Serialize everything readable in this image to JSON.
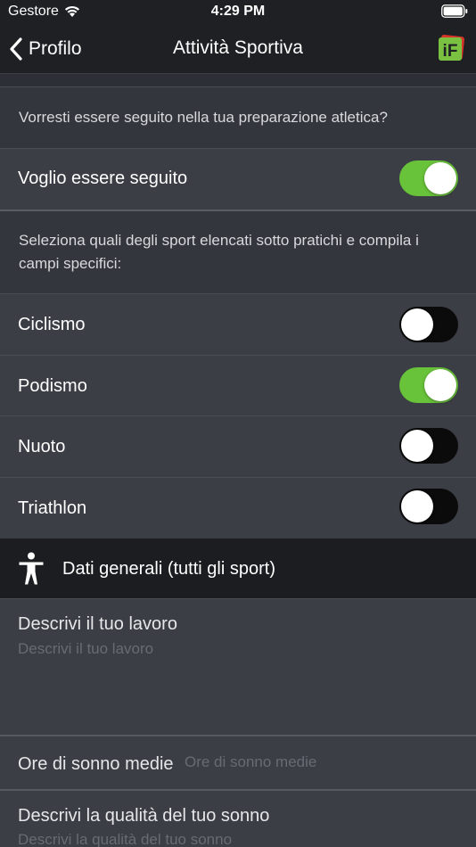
{
  "status_bar": {
    "carrier": "Gestore",
    "time": "4:29 PM",
    "wifi_icon": "wifi-icon",
    "battery_icon": "battery-icon"
  },
  "nav": {
    "back_label": "Profilo",
    "title": "Attività Sportiva",
    "logo_text": "iF",
    "logo_color": "#7ac142"
  },
  "follow_section": {
    "question": "Vorresti essere seguito nella tua preparazione atletica?",
    "toggle_label": "Voglio essere seguito",
    "toggle_on": true
  },
  "sports_section": {
    "instructions": "Seleziona quali degli sport elencati sotto pratichi e compila i campi specifici:",
    "sports": [
      {
        "label": "Ciclismo",
        "on": false
      },
      {
        "label": "Podismo",
        "on": true
      },
      {
        "label": "Nuoto",
        "on": false
      },
      {
        "label": "Triathlon",
        "on": false
      }
    ]
  },
  "general_section": {
    "header": "Dati generali (tutti gli sport)",
    "header_icon": "person-icon",
    "job": {
      "label": "Descrivi il tuo lavoro",
      "placeholder": "Descrivi il tuo lavoro",
      "value": ""
    },
    "sleep_hours": {
      "label": "Ore di sonno medie",
      "placeholder": "Ore di sonno medie",
      "value": ""
    },
    "sleep_quality": {
      "label": "Descrivi la qualità del tuo sonno",
      "placeholder": "Descrivi la qualità del tuo sonno",
      "value": ""
    }
  },
  "colors": {
    "toggle_on": "#68c23a",
    "toggle_off": "#0b0b0c",
    "background": "#33363d",
    "header_background": "#1c1d20"
  }
}
